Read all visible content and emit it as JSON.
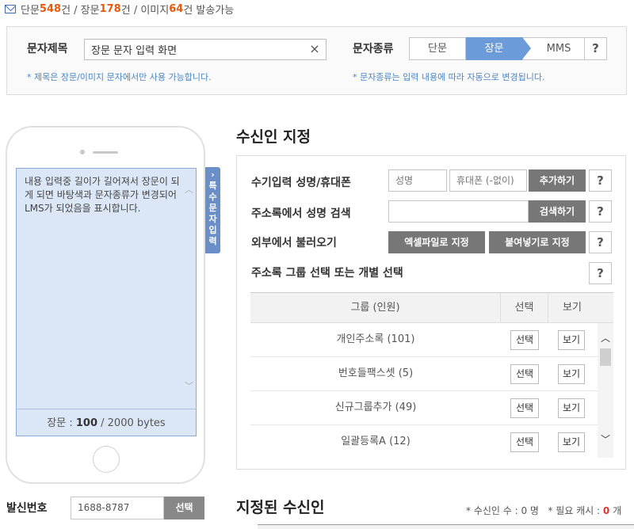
{
  "quota": {
    "p1": "단문 ",
    "short_count": "548",
    "p2": "건 / 장문 ",
    "long_count": "178",
    "p3": "건 / 이미지 ",
    "image_count": "64",
    "p4": "건 발송가능"
  },
  "title_section": {
    "label": "문자제목",
    "value": "장문 문자 입력 화면",
    "clear": "×",
    "note": "* 제목은 장문/이미지 문자에서만 사용 가능합니다."
  },
  "type_section": {
    "label": "문자종류",
    "options": [
      "단문",
      "장문",
      "MMS"
    ],
    "selected": "장문",
    "help": "?",
    "note": "* 문자종류는 입력 내용에 따라 자동으로 변경됩니다."
  },
  "phone": {
    "message": "내용 입력중 길이가 길어져서 장문이 되게 되면 바탕색과 문자종류가 변경되어 LMS가 되었음을 표시합니다.",
    "scroll_up": "︿",
    "scroll_down": "﹀",
    "bytes_prefix": "장문 : ",
    "bytes_used": "100",
    "bytes_suffix": " / 2000 bytes",
    "side_tab_arrow": "›",
    "side_tab_chars": [
      "특",
      "수",
      "문",
      "자",
      "입",
      "력"
    ]
  },
  "recipient": {
    "title": "수신인 지정",
    "manual_label": "수기입력 성명/휴대폰",
    "name_placeholder": "성명",
    "phone_placeholder": "휴대폰 (-없이)",
    "add_button": "추가하기",
    "search_label": "주소록에서 성명 검색",
    "search_button": "검색하기",
    "external_label": "외부에서 불러오기",
    "excel_button": "엑셀파일로 지정",
    "paste_button": "붙여넣기로 지정",
    "group_label": "주소록 그룹 선택 또는 개별 선택",
    "help": "?",
    "table": {
      "headers": [
        "그룹 (인원)",
        "선택",
        "보기"
      ],
      "rows": [
        {
          "name": "개인주소록 (101)",
          "select": "선택",
          "view": "보기"
        },
        {
          "name": "번호들팩스셋 (5)",
          "select": "선택",
          "view": "보기"
        },
        {
          "name": "신규그룹추가 (49)",
          "select": "선택",
          "view": "보기"
        },
        {
          "name": "일괄등록A (12)",
          "select": "선택",
          "view": "보기"
        }
      ],
      "scroll_up": "︿",
      "scroll_down": "﹀"
    }
  },
  "sender": {
    "label": "발신번호",
    "value": "1688-8787",
    "button": "선택"
  },
  "assigned": {
    "title": "지정된 수신인",
    "count_label": "* 수신인 수 : ",
    "count": "0",
    "count_unit": " 명",
    "cash_label": "* 필요 캐시 : ",
    "cash": "0",
    "cash_unit": " 개"
  }
}
